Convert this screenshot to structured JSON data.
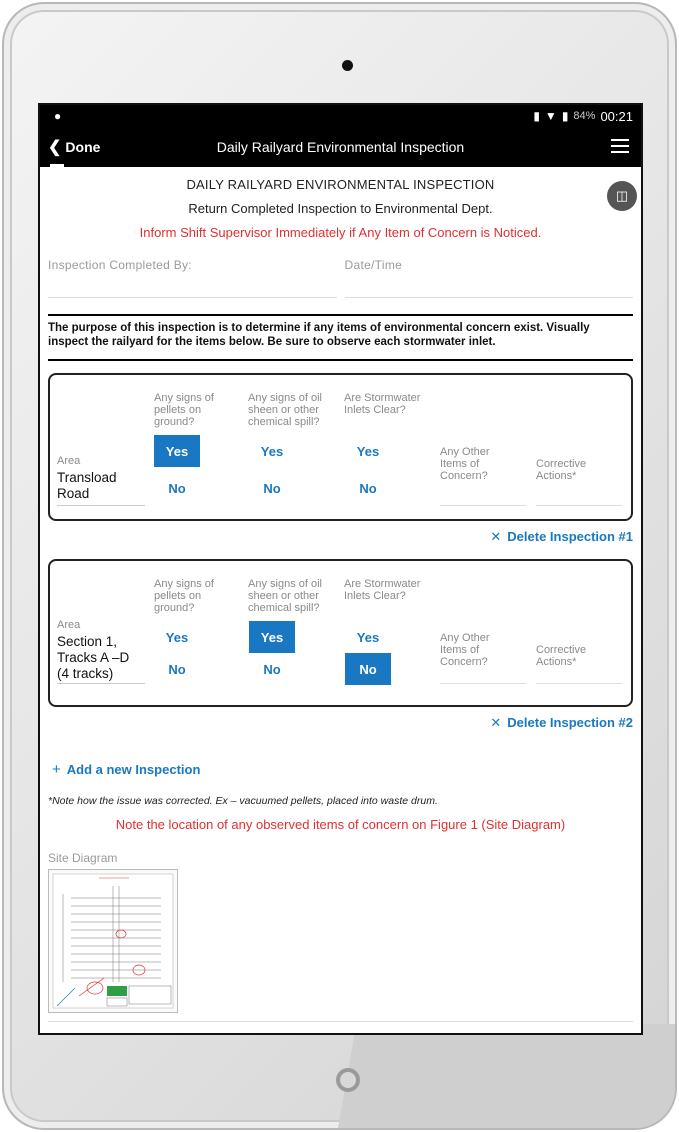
{
  "status": {
    "battery": "84%",
    "time": "00:21"
  },
  "appbar": {
    "done_label": "Done",
    "title": "Daily Railyard Environmental Inspection"
  },
  "header": {
    "title": "DAILY RAILYARD ENVIRONMENTAL INSPECTION",
    "subtitle": "Return Completed Inspection to Environmental Dept.",
    "warning": "Inform Shift Supervisor Immediately if Any Item of Concern is Noticed."
  },
  "fields": {
    "completed_by_label": "Inspection Completed By:",
    "datetime_label": "Date/Time"
  },
  "purpose": "The purpose of this inspection is to determine if any items of environmental concern exist. Visually inspect the railyard for the items below. Be sure to observe each stormwater inlet.",
  "questions": {
    "q1": "Any signs of pellets on ground?",
    "q2": "Any signs of oil sheen or other chemical spill?",
    "q3": "Are Stormwater Inlets Clear?",
    "q4": "Any Other Items of Concern?",
    "q5": "Corrective Actions*",
    "area": "Area",
    "yes": "Yes",
    "no": "No"
  },
  "inspections": [
    {
      "area": "Transload Road",
      "q1": "Yes",
      "q2": null,
      "q3": null,
      "delete_label": "Delete Inspection #1"
    },
    {
      "area": "Section 1, Tracks A –D (4 tracks)",
      "q1": null,
      "q2": "Yes",
      "q3": "No",
      "delete_label": "Delete Inspection #2"
    }
  ],
  "add_label": "Add a new Inspection",
  "note": "*Note how the issue was corrected. Ex – vacuumed pellets, placed into waste drum.",
  "figure_note": "Note the location of any observed items of concern on Figure 1 (Site Diagram)",
  "site_diagram_label": "Site Diagram",
  "colors": {
    "accent": "#1a78c2",
    "warning": "#e03030",
    "appbar": "#000000"
  },
  "icons": [
    "back-chevron-icon",
    "menu-icon",
    "book-icon",
    "delete-x-icon",
    "plus-icon",
    "vibrate-icon",
    "wifi-icon",
    "battery-icon"
  ]
}
